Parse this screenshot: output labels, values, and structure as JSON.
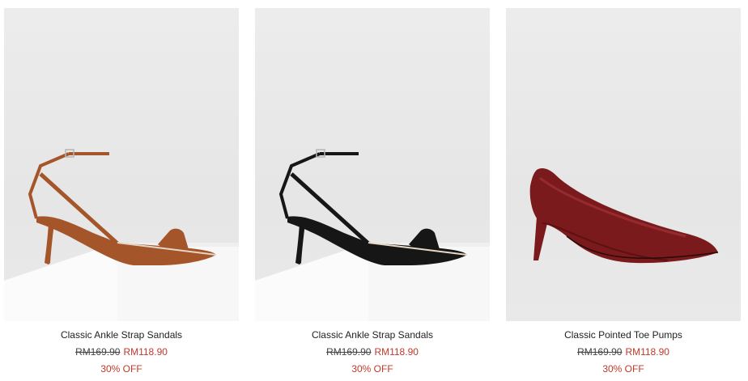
{
  "products": [
    {
      "name": "Classic Ankle Strap Sandals",
      "original_price": "RM169.90",
      "sale_price": "RM118.90",
      "discount": "30% OFF",
      "shoe_color": "#a4552a",
      "image_alt": "Classic Ankle Strap Sandals in cognac"
    },
    {
      "name": "Classic Ankle Strap Sandals",
      "original_price": "RM169.90",
      "sale_price": "RM118.90",
      "discount": "30% OFF",
      "shoe_color": "#161616",
      "image_alt": "Classic Ankle Strap Sandals in black"
    },
    {
      "name": "Classic Pointed Toe Pumps",
      "original_price": "RM169.90",
      "sale_price": "RM118.90",
      "discount": "30% OFF",
      "shoe_color": "#7a1a1c",
      "image_alt": "Classic Pointed Toe Pumps in burgundy"
    }
  ],
  "colors": {
    "sale": "#c0392b",
    "text": "#222222",
    "photo_bg": "#e8e8e8",
    "pedestal": "#f7f7f7"
  }
}
